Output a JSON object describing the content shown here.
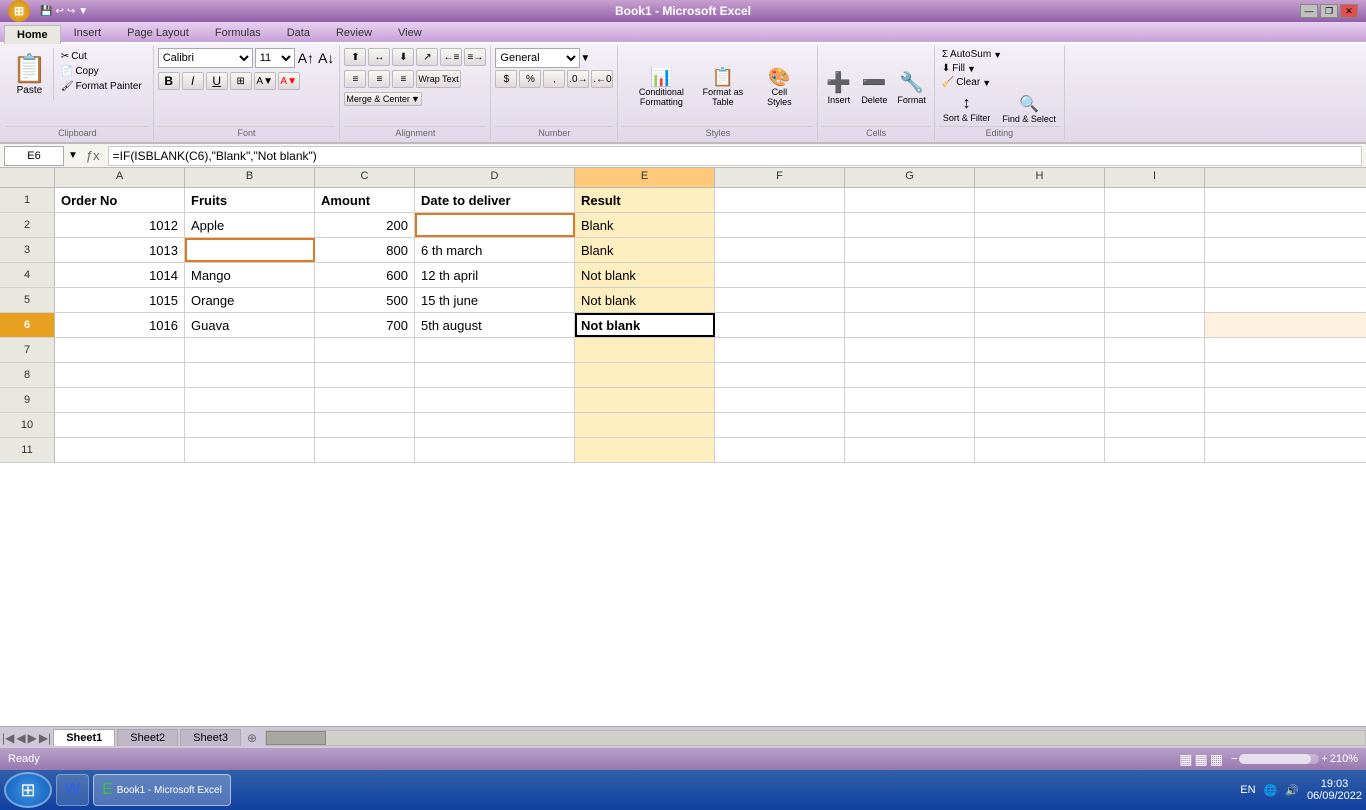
{
  "titleBar": {
    "title": "Book1 - Microsoft Excel",
    "minimize": "—",
    "restore": "❐",
    "close": "✕"
  },
  "tabs": [
    "Home",
    "Insert",
    "Page Layout",
    "Formulas",
    "Data",
    "Review",
    "View"
  ],
  "activeTab": "Home",
  "ribbon": {
    "groups": {
      "clipboard": {
        "label": "Clipboard",
        "paste": "Paste",
        "cut": "Cut",
        "copy": "Copy",
        "formatPainter": "Format Painter"
      },
      "font": {
        "label": "Font",
        "fontName": "Calibri",
        "fontSize": "11",
        "bold": "B",
        "italic": "I",
        "underline": "U"
      },
      "alignment": {
        "label": "Alignment",
        "wrapText": "Wrap Text",
        "mergeCenterLabel": "Merge & Center"
      },
      "number": {
        "label": "Number",
        "format": "General"
      },
      "styles": {
        "label": "Styles",
        "conditionalFormatting": "Conditional Formatting",
        "formatAsTable": "Format as Table",
        "cellStyles": "Cell Styles"
      },
      "cells": {
        "label": "Cells",
        "insert": "Insert",
        "delete": "Delete",
        "format": "Format"
      },
      "editing": {
        "label": "Editing",
        "autoSum": "AutoSum",
        "fill": "Fill",
        "clear": "Clear",
        "sortFilter": "Sort & Filter",
        "findSelect": "Find & Select"
      }
    }
  },
  "formulaBar": {
    "cellRef": "E6",
    "formula": "=IF(ISBLANK(C6),\"Blank\",\"Not blank\")"
  },
  "columns": [
    "A",
    "B",
    "C",
    "D",
    "E",
    "F",
    "G",
    "H",
    "I"
  ],
  "rows": [
    {
      "num": "1",
      "cells": [
        "Order No",
        "Fruits",
        "Amount",
        "Date to deliver",
        "Result",
        "",
        "",
        "",
        ""
      ]
    },
    {
      "num": "2",
      "cells": [
        "1012",
        "Apple",
        "200",
        "",
        "Blank",
        "",
        "",
        "",
        ""
      ]
    },
    {
      "num": "3",
      "cells": [
        "1013",
        "",
        "800",
        "6 th march",
        "Blank",
        "",
        "",
        "",
        ""
      ]
    },
    {
      "num": "4",
      "cells": [
        "1014",
        "Mango",
        "600",
        "12 th april",
        "Not blank",
        "",
        "",
        "",
        ""
      ]
    },
    {
      "num": "5",
      "cells": [
        "1015",
        "Orange",
        "500",
        "15 th june",
        "Not blank",
        "",
        "",
        "",
        ""
      ]
    },
    {
      "num": "6",
      "cells": [
        "1016",
        "Guava",
        "700",
        "5th august",
        "Not blank",
        "",
        "",
        "",
        ""
      ]
    },
    {
      "num": "7",
      "cells": [
        "",
        "",
        "",
        "",
        "",
        "",
        "",
        "",
        ""
      ]
    },
    {
      "num": "8",
      "cells": [
        "",
        "",
        "",
        "",
        "",
        "",
        "",
        "",
        ""
      ]
    },
    {
      "num": "9",
      "cells": [
        "",
        "",
        "",
        "",
        "",
        "",
        "",
        "",
        ""
      ]
    },
    {
      "num": "10",
      "cells": [
        "",
        "",
        "",
        "",
        "",
        "",
        "",
        "",
        ""
      ]
    },
    {
      "num": "11",
      "cells": [
        "",
        "",
        "",
        "",
        "",
        "",
        "",
        "",
        ""
      ]
    }
  ],
  "sheetTabs": [
    "Sheet1",
    "Sheet2",
    "Sheet3"
  ],
  "activeSheet": "Sheet1",
  "statusBar": {
    "status": "Ready",
    "zoom": "210%",
    "zoomMinus": "−",
    "zoomPlus": "+"
  },
  "taskbar": {
    "startLabel": "⊞",
    "apps": [
      "W",
      "E"
    ],
    "time": "19:03",
    "date": "06/09/2022",
    "lang": "EN"
  }
}
